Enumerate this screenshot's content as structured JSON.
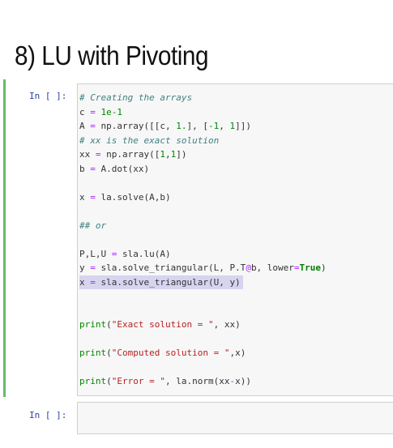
{
  "heading": "8) LU with Pivoting",
  "cells": [
    {
      "prompt": "In [ ]:"
    },
    {
      "prompt": "In [ ]:"
    }
  ],
  "code_lines": [
    [
      {
        "t": "# Creating the arrays",
        "c": "cm"
      }
    ],
    [
      {
        "t": "c "
      },
      {
        "t": "=",
        "c": "op"
      },
      {
        "t": " "
      },
      {
        "t": "1e-1",
        "c": "num"
      }
    ],
    [
      {
        "t": "A "
      },
      {
        "t": "=",
        "c": "op"
      },
      {
        "t": " np.array([[c, "
      },
      {
        "t": "1.",
        "c": "num"
      },
      {
        "t": "], ["
      },
      {
        "t": "-1",
        "c": "num"
      },
      {
        "t": ", "
      },
      {
        "t": "1",
        "c": "num"
      },
      {
        "t": "]])"
      }
    ],
    [
      {
        "t": "# xx is the exact solution",
        "c": "cm"
      }
    ],
    [
      {
        "t": "xx "
      },
      {
        "t": "=",
        "c": "op"
      },
      {
        "t": " np.array(["
      },
      {
        "t": "1",
        "c": "num"
      },
      {
        "t": ","
      },
      {
        "t": "1",
        "c": "num"
      },
      {
        "t": "])"
      }
    ],
    [
      {
        "t": "b "
      },
      {
        "t": "=",
        "c": "op"
      },
      {
        "t": " A.dot(xx)"
      }
    ],
    [],
    [
      {
        "t": "x "
      },
      {
        "t": "=",
        "c": "op"
      },
      {
        "t": " la.solve(A,b)"
      }
    ],
    [],
    [
      {
        "t": "## or",
        "c": "cm"
      }
    ],
    [],
    [
      {
        "t": "P,L,U "
      },
      {
        "t": "=",
        "c": "op"
      },
      {
        "t": " sla.lu(A)"
      }
    ],
    [
      {
        "t": "y "
      },
      {
        "t": "=",
        "c": "op"
      },
      {
        "t": " sla.solve_triangular(L, P.T"
      },
      {
        "t": "@",
        "c": "op"
      },
      {
        "t": "b, lower"
      },
      {
        "t": "=",
        "c": "op"
      },
      {
        "t": "True",
        "c": "kw"
      },
      {
        "t": ")"
      }
    ],
    [
      {
        "t": "x "
      },
      {
        "t": "=",
        "c": "op"
      },
      {
        "t": " sla.solve_triangular(U, y)"
      }
    ],
    [],
    [],
    [
      {
        "t": "print",
        "c": "num"
      },
      {
        "t": "("
      },
      {
        "t": "\"Exact solution = \"",
        "c": "str"
      },
      {
        "t": ", xx)"
      }
    ],
    [],
    [
      {
        "t": "print",
        "c": "num"
      },
      {
        "t": "("
      },
      {
        "t": "\"Computed solution = \"",
        "c": "str"
      },
      {
        "t": ",x)"
      }
    ],
    [],
    [
      {
        "t": "print",
        "c": "num"
      },
      {
        "t": "("
      },
      {
        "t": "\"Error = \"",
        "c": "str"
      },
      {
        "t": ", la.norm(xx"
      },
      {
        "t": "-",
        "c": "op"
      },
      {
        "t": "x))"
      }
    ]
  ],
  "selected_line": 13
}
